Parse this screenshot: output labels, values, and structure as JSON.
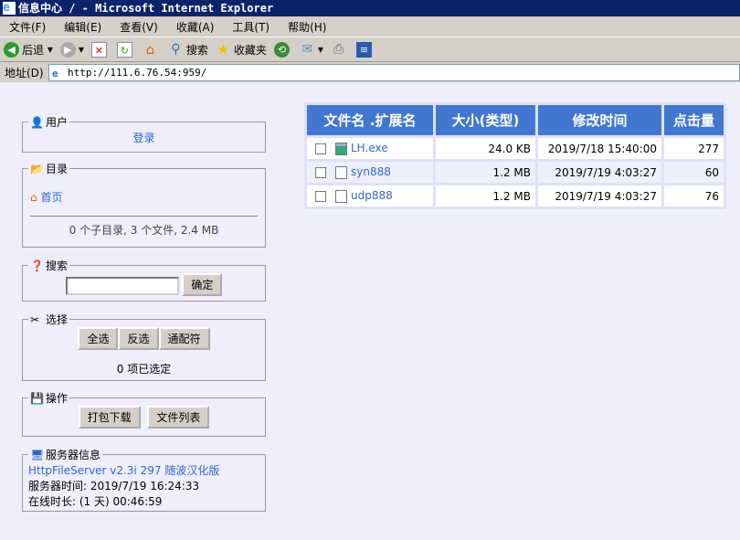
{
  "window": {
    "title": "信息中心 / - Microsoft Internet Explorer"
  },
  "menu": [
    "文件(F)",
    "编辑(E)",
    "查看(V)",
    "收藏(A)",
    "工具(T)",
    "帮助(H)"
  ],
  "toolbar": {
    "back": "后退",
    "search": "搜索",
    "favorites": "收藏夹"
  },
  "address": {
    "label": "地址(D)",
    "url": "http://111.6.76.54:959/"
  },
  "user": {
    "legend": "用户",
    "login": "登录"
  },
  "folder": {
    "legend": "目录",
    "home": "首页",
    "summary": "0 个子目录, 3 个文件, 2.4 MB"
  },
  "search": {
    "legend": "搜索",
    "value": "",
    "button": "确定"
  },
  "select": {
    "legend": "选择",
    "all": "全选",
    "invert": "反选",
    "wildcard": "通配符",
    "status": "0 项已选定"
  },
  "actions": {
    "legend": "操作",
    "zip": "打包下载",
    "list": "文件列表"
  },
  "server": {
    "legend": "服务器信息",
    "software": "HttpFileServer v2.3i 297 随波汉化版",
    "time": "服务器时间: 2019/7/19 16:24:33",
    "uptime": "在线时长: (1 天) 00:46:59"
  },
  "table": {
    "headers": [
      "文件名 .扩展名",
      "大小(类型)",
      "修改时间",
      "点击量"
    ],
    "rows": [
      {
        "name": "LH.exe",
        "size": "24.0 KB",
        "modified": "2019/7/18 15:40:00",
        "hits": "277"
      },
      {
        "name": "syn888",
        "size": "1.2 MB",
        "modified": "2019/7/19 4:03:27",
        "hits": "60"
      },
      {
        "name": "udp888",
        "size": "1.2 MB",
        "modified": "2019/7/19 4:03:27",
        "hits": "76"
      }
    ]
  }
}
